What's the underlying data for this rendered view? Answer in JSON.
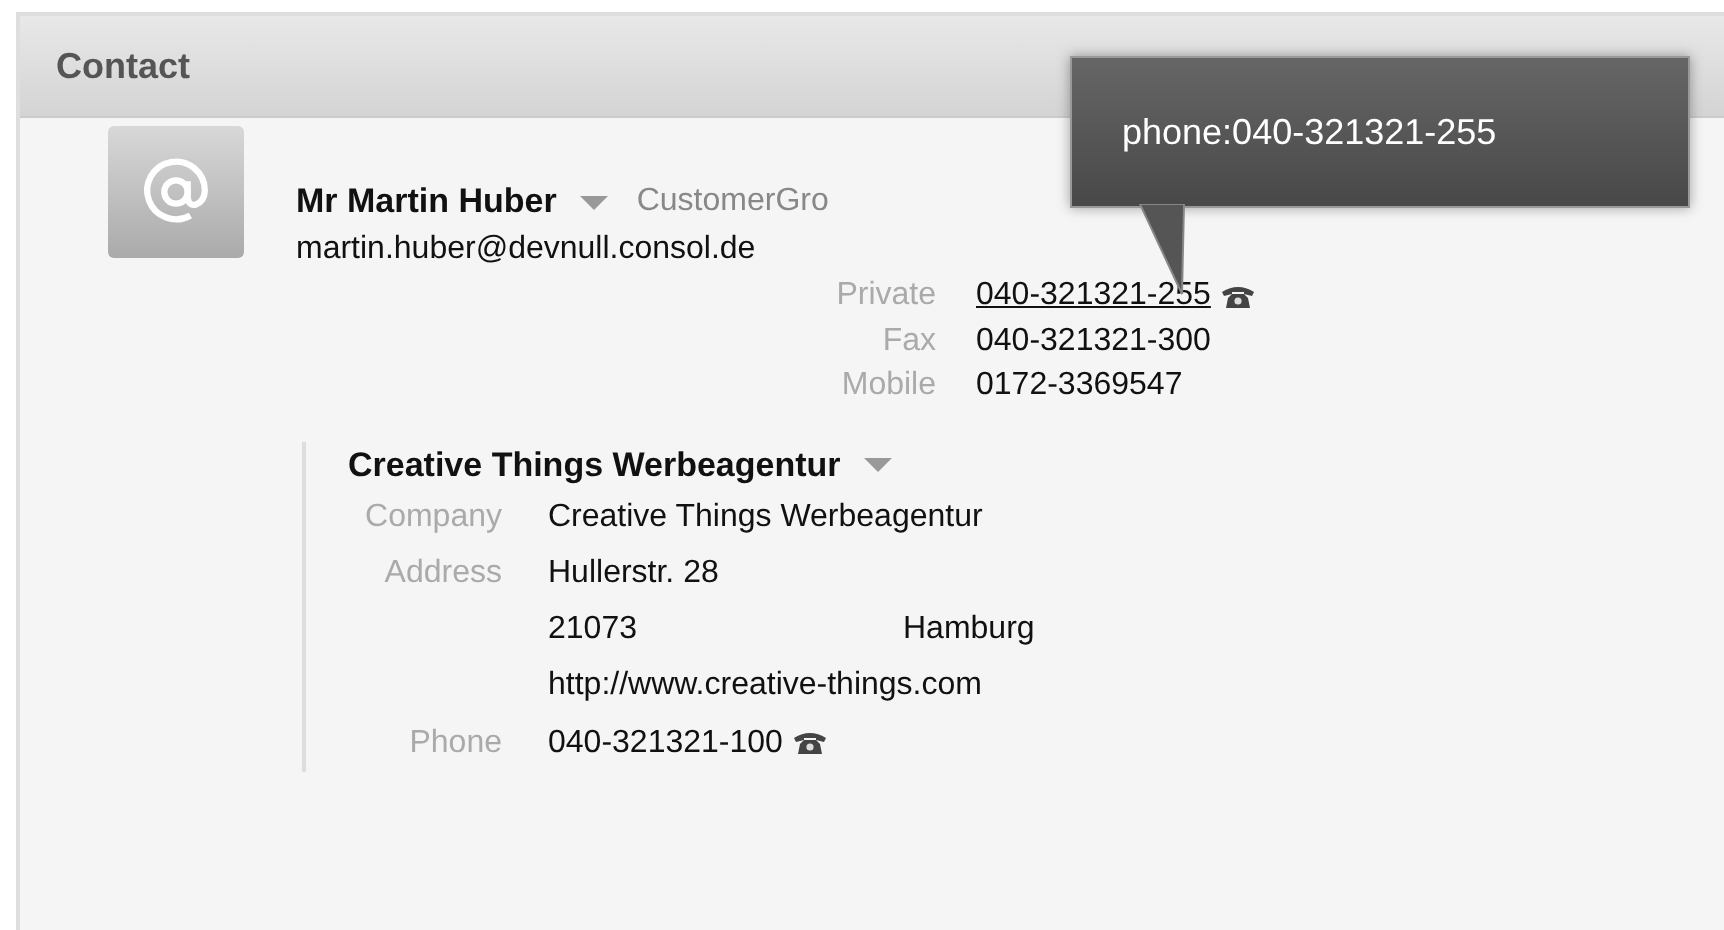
{
  "panel": {
    "title": "Contact"
  },
  "person": {
    "name": "Mr Martin Huber",
    "group": "CustomerGro",
    "email": "martin.huber@devnull.consol.de",
    "fields": [
      {
        "label": "Private",
        "value": "040-321321-255",
        "kind": "phone",
        "hovered": true
      },
      {
        "label": "Fax",
        "value": "040-321321-300",
        "kind": "plain",
        "hovered": false
      },
      {
        "label": "Mobile",
        "value": "0172-3369547",
        "kind": "plain",
        "hovered": false
      }
    ]
  },
  "company": {
    "name": "Creative Things Werbeagentur",
    "fields": [
      {
        "label": "Company",
        "value": "Creative Things Werbeagentur",
        "kind": "plain"
      },
      {
        "label": "Address",
        "value": "Hullerstr. 28",
        "kind": "plain"
      },
      {
        "value": "21073",
        "value_2": "Hamburg",
        "kind": "plain"
      },
      {
        "value": "http://www.creative-things.com",
        "kind": "plain"
      },
      {
        "label": "Phone",
        "value": "040-321321-100",
        "kind": "phone"
      }
    ]
  },
  "tooltip": {
    "text": "phone:040-321321-255"
  }
}
